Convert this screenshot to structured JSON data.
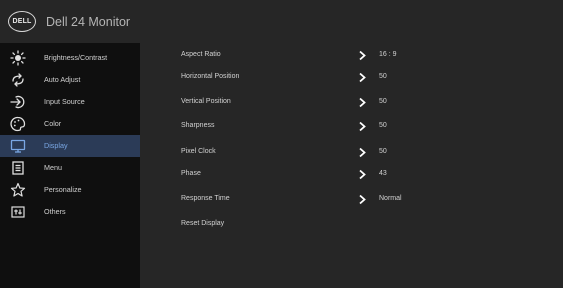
{
  "header": {
    "logo_text": "DELL",
    "title": "Dell 24 Monitor"
  },
  "sidebar": {
    "items": [
      {
        "label": "Brightness/Contrast",
        "icon": "brightness-icon"
      },
      {
        "label": "Auto Adjust",
        "icon": "auto-adjust-icon"
      },
      {
        "label": "Input Source",
        "icon": "input-source-icon"
      },
      {
        "label": "Color",
        "icon": "color-icon"
      },
      {
        "label": "Display",
        "icon": "display-icon",
        "active": true
      },
      {
        "label": "Menu",
        "icon": "menu-icon"
      },
      {
        "label": "Personalize",
        "icon": "star-icon"
      },
      {
        "label": "Others",
        "icon": "others-icon"
      }
    ]
  },
  "display": {
    "rows": [
      {
        "label": "Aspect Ratio",
        "value": "16 : 9"
      },
      {
        "label": "Horizontal Position",
        "value": "50"
      },
      {
        "label": "Vertical Position",
        "value": "50"
      },
      {
        "label": "Sharpness",
        "value": "50"
      },
      {
        "label": "Pixel Clock",
        "value": "50"
      },
      {
        "label": "Phase",
        "value": "43"
      },
      {
        "label": "Response Time",
        "value": "Normal"
      },
      {
        "label": "Reset Display",
        "value": ""
      }
    ]
  },
  "colors": {
    "header_bg": "#262626",
    "sidebar_bg": "#0f0f0f",
    "active_bg": "#2b3b57",
    "active_text": "#7aa7e4",
    "text": "#d2d2d2"
  }
}
